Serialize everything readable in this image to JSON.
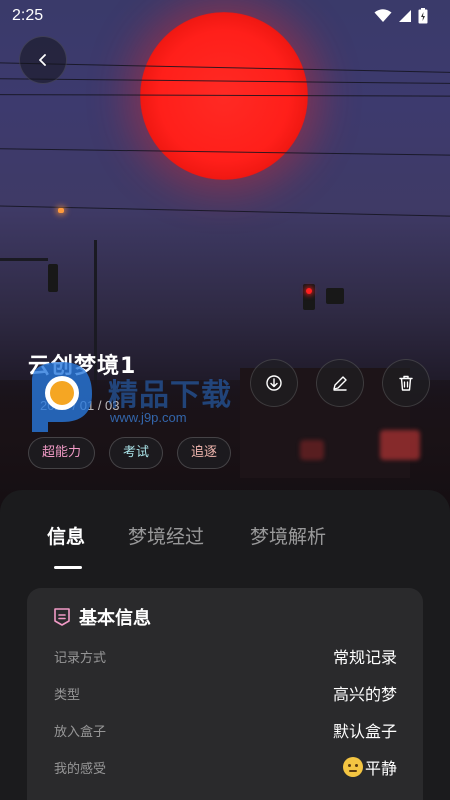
{
  "status": {
    "time": "2:25"
  },
  "dream": {
    "title": "云创梦境1",
    "date": "2025 / 01 / 03"
  },
  "tags": [
    {
      "label": "超能力",
      "color": "#f19ac6"
    },
    {
      "label": "考试",
      "color": "#a9e2e7"
    },
    {
      "label": "追逐",
      "color": "#f2b8b0"
    }
  ],
  "tabs": [
    {
      "label": "信息",
      "active": true
    },
    {
      "label": "梦境经过",
      "active": false
    },
    {
      "label": "梦境解析",
      "active": false
    }
  ],
  "basic_info": {
    "title": "基本信息",
    "rows": [
      {
        "label": "记录方式",
        "value": "常规记录"
      },
      {
        "label": "类型",
        "value": "高兴的梦"
      },
      {
        "label": "放入盒子",
        "value": "默认盒子"
      },
      {
        "label": "我的感受",
        "value": "平静"
      }
    ]
  },
  "watermark": {
    "text": "精品下载",
    "url": "www.j9p.com"
  },
  "icons": {
    "back": "chevron-left-icon",
    "download": "download-icon",
    "edit": "pencil-icon",
    "delete": "trash-icon",
    "info": "document-icon"
  },
  "colors": {
    "accent_pink": "#f19ac6",
    "sheet_bg": "#1b1b1d",
    "card_bg": "#2a2a2c"
  }
}
